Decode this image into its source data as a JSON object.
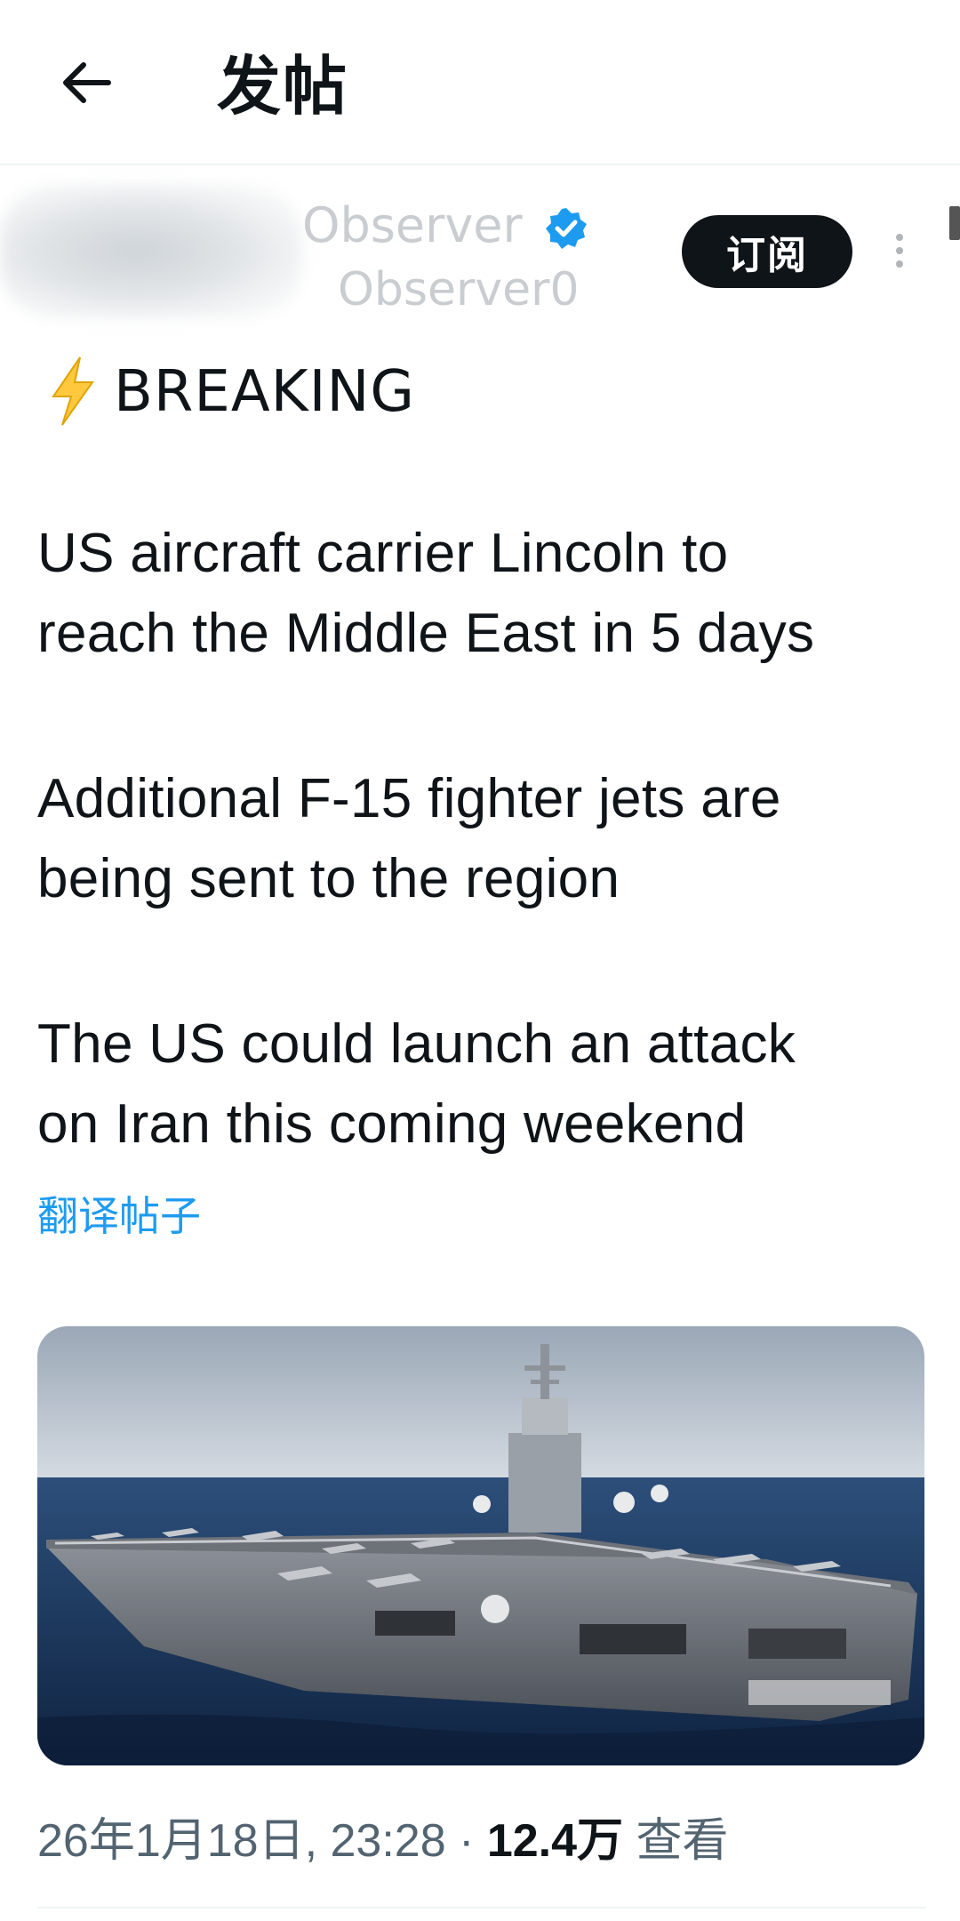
{
  "header": {
    "title": "发帖",
    "back_icon": "arrow-left-icon"
  },
  "author": {
    "display_name": "Observer",
    "handle": "Observer0",
    "verified_icon": "verified-badge-icon",
    "subscribe_label": "订阅",
    "more_icon": "more-vertical-icon"
  },
  "post": {
    "bolt_icon": "lightning-bolt-icon",
    "breaking": "BREAKING",
    "paragraphs": [
      [
        "US aircraft carrier Lincoln to",
        "reach the Middle East in 5 days"
      ],
      [
        "Additional F-15 fighter jets are",
        "being sent to the region"
      ],
      [
        "The US could launch an attack",
        "on Iran this coming weekend"
      ]
    ],
    "translate_label": "翻译帖子",
    "image_subject": "aircraft-carrier-photo"
  },
  "meta": {
    "timestamp": "26年1月18日, 23:28",
    "separator": " · ",
    "views_count": "12.4万",
    "views_label": " 查看"
  },
  "colors": {
    "link": "#1d9bf0",
    "verified": "#1d9bf0",
    "text": "#0f1419",
    "muted": "#536471"
  }
}
